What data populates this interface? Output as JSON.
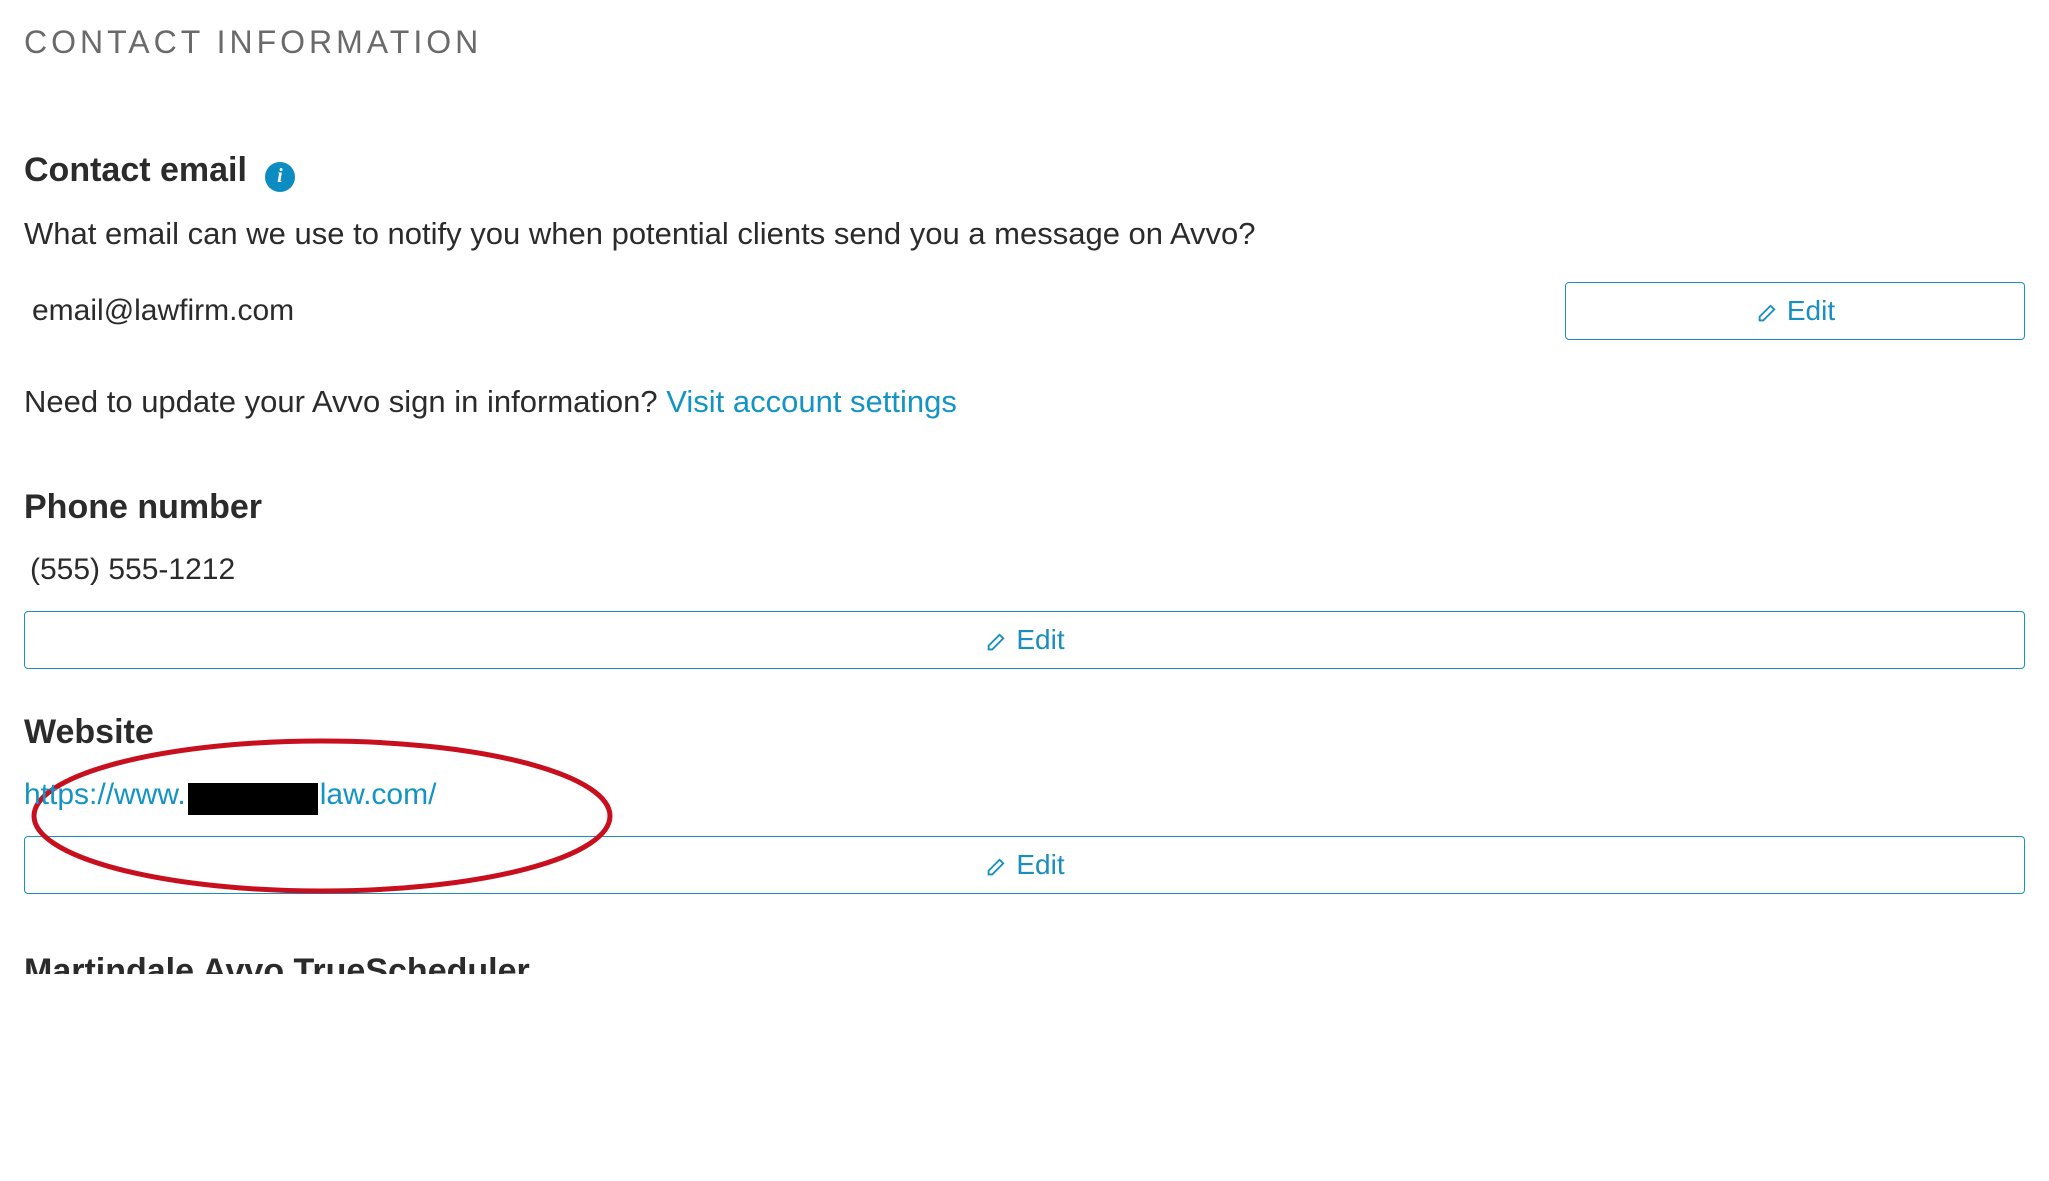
{
  "section_title": "CONTACT INFORMATION",
  "contact_email": {
    "heading": "Contact email",
    "description": "What email can we use to notify you when potential clients send you a message on Avvo?",
    "value": "email@lawfirm.com",
    "edit_label": "Edit",
    "signin_prefix": "Need to update your Avvo sign in information?  ",
    "signin_link": "Visit account settings"
  },
  "phone": {
    "heading": "Phone number",
    "value": "(555) 555-1212",
    "edit_label": "Edit"
  },
  "website": {
    "heading": "Website",
    "url_prefix": "https://www.",
    "url_suffix": "law.com/",
    "edit_label": "Edit"
  },
  "truncated": {
    "heading": "Martindale Avvo TrueScheduler"
  },
  "icons": {
    "info": "info-icon",
    "pencil": "pencil-icon"
  },
  "colors": {
    "accent": "#198fbf",
    "link": "#1494c5",
    "text": "#2b2b2b",
    "muted": "#6a6a6a",
    "annotation": "#c80f1e"
  }
}
